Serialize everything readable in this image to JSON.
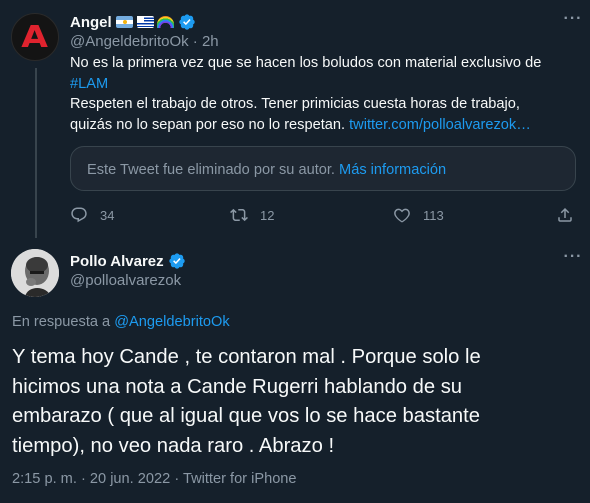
{
  "tweet1": {
    "author_name": "Angel",
    "avatar_letter": "A",
    "emoji_icons": [
      "argentina-flag-icon",
      "uruguay-flag-icon",
      "rainbow-icon"
    ],
    "handle": "@AngeldebritoOk",
    "separator": "·",
    "time": "2h",
    "text_line1": "No es la primera vez que se hacen los boludos con material exclusivo de",
    "hashtag": "#LAM",
    "text_line3": "Respeten el trabajo de otros. Tener primicias cuesta horas de trabajo,",
    "text_line4": "quizás no lo sepan por eso no lo respetan.",
    "link": "twitter.com/polloalvarezok…",
    "deleted_notice": "Este Tweet fue eliminado por su autor.",
    "more_info_link": "Más información",
    "replies": "34",
    "retweets": "12",
    "likes": "113"
  },
  "tweet2": {
    "author_name": "Pollo Alvarez",
    "handle": "@polloalvarezok",
    "reply_prefix": "En respuesta a",
    "reply_to": "@AngeldebritoOk",
    "text_line1": "Y tema hoy Cande , te contaron mal . Porque solo le",
    "text_line2": "hicimos una nota a Cande Rugerri hablando de su",
    "text_line3": "embarazo ( que al igual que vos lo se hace bastante",
    "text_line4": "tiempo), no veo nada raro . Abrazo !",
    "time": "2:15 p. m.",
    "separator": "·",
    "date": "20 jun. 2022",
    "source": "Twitter for iPhone"
  },
  "colors": {
    "background": "#15202b",
    "text": "#f7f9f9",
    "secondary": "#8b98a5",
    "link": "#1d9bf0",
    "verified": "#1d9bf0",
    "border": "#38444d"
  }
}
